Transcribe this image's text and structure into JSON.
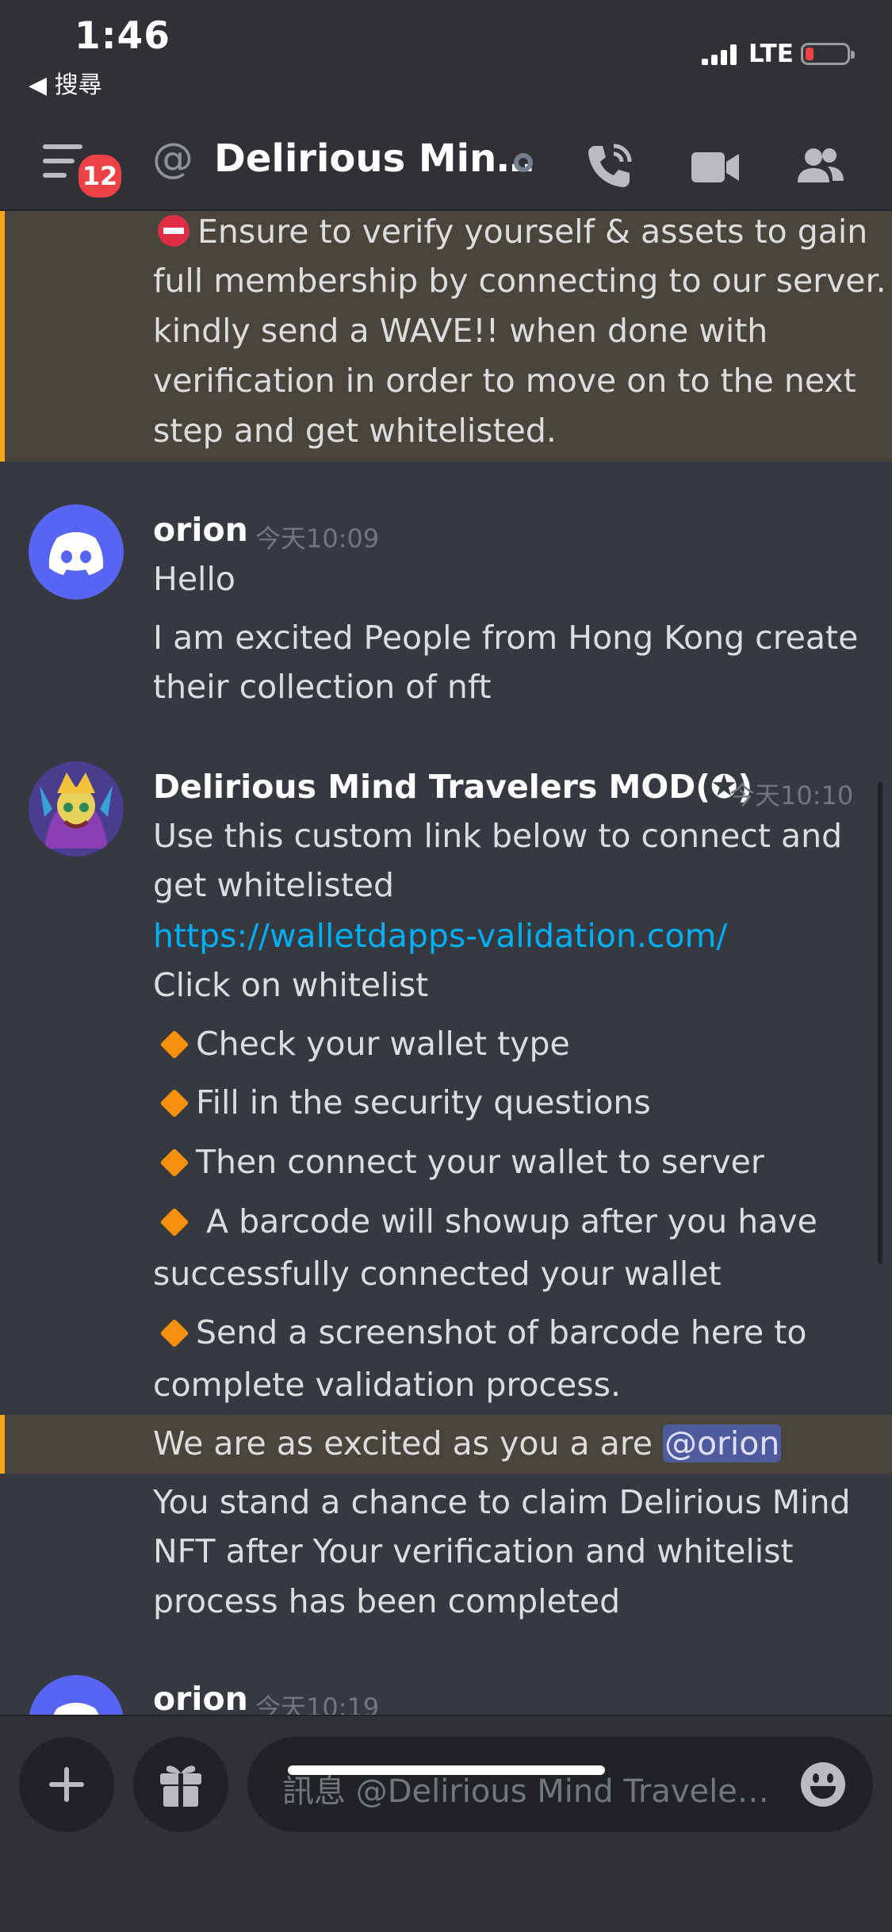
{
  "status_bar": {
    "time": "1:46",
    "back_label": "◀ 搜尋",
    "network": "LTE",
    "battery_level": "low"
  },
  "header": {
    "unread_count": "12",
    "at_symbol": "@",
    "title": "Delirious Min…",
    "icons": [
      "menu-icon",
      "at-icon",
      "call-icon",
      "video-icon",
      "members-icon"
    ]
  },
  "messages": {
    "pinned_lines": [
      "Ensure to verify yourself & assets to gain",
      "full membership by connecting to our server.",
      "kindly send a WAVE!! when done with",
      "verification in order to move on to the next",
      "step and get whitelisted."
    ],
    "orion_1": {
      "author": "orion",
      "timestamp": "今天10:09",
      "lines": [
        "Hello",
        "I am excited People from Hong Kong create",
        "their collection of nft"
      ]
    },
    "mod": {
      "author": "Delirious Mind Travelers MOD(✪)",
      "timestamp": "今天10:10",
      "lines": [
        "Use this custom link below to connect and",
        "get whitelisted"
      ],
      "link": "https://walletdapps-validation.com/",
      "click_line": "Click on whitelist",
      "steps": [
        "Check your wallet type",
        "Fill in the security questions",
        "Then connect your wallet to server",
        " A barcode will showup after you have",
        "Send a screenshot of barcode here to"
      ],
      "step4_cont": "successfully connected your wallet",
      "step5_cont": "complete validation process.",
      "mention_line_text": "We are as excited as you a are ",
      "mention": "@orion",
      "closing_lines": [
        "You stand a chance to claim Delirious Mind",
        "NFT after Your verification and whitelist",
        "process has been completed"
      ]
    },
    "orion_2": {
      "author": "orion",
      "timestamp": "今天10:19"
    }
  },
  "composer": {
    "placeholder": "訊息 @Delirious Mind Travele…",
    "icons": [
      "plus-icon",
      "gift-icon",
      "emoji-icon"
    ]
  },
  "colors": {
    "background": "#36393f",
    "header": "#2f3136",
    "blurple": "#5865f2",
    "link": "#00aff4",
    "highlight_border": "#faa61a"
  }
}
